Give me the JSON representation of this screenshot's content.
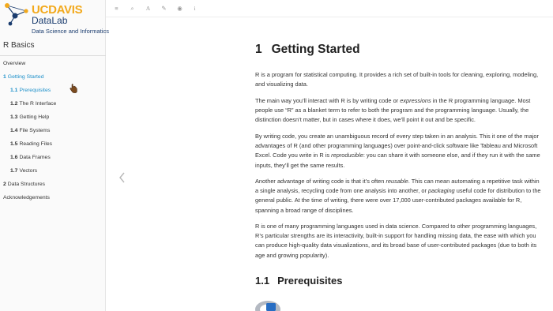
{
  "sidebar": {
    "logo": {
      "uc": "UC",
      "davis": "DAVIS",
      "datalab": "DataLab",
      "subtitle": "Data Science and Informatics"
    },
    "book_title": "R Basics",
    "toc": [
      {
        "num": "",
        "label": "Overview",
        "level": 1,
        "active": false
      },
      {
        "num": "1",
        "label": "Getting Started",
        "level": 1,
        "active": true
      },
      {
        "num": "1.1",
        "label": "Prerequisites",
        "level": 2,
        "active": true
      },
      {
        "num": "1.2",
        "label": "The R Interface",
        "level": 2,
        "active": false
      },
      {
        "num": "1.3",
        "label": "Getting Help",
        "level": 2,
        "active": false
      },
      {
        "num": "1.4",
        "label": "File Systems",
        "level": 2,
        "active": false
      },
      {
        "num": "1.5",
        "label": "Reading Files",
        "level": 2,
        "active": false
      },
      {
        "num": "1.6",
        "label": "Data Frames",
        "level": 2,
        "active": false
      },
      {
        "num": "1.7",
        "label": "Vectors",
        "level": 2,
        "active": false
      },
      {
        "num": "2",
        "label": "Data Structures",
        "level": 1,
        "active": false
      },
      {
        "num": "",
        "label": "Acknowledgements",
        "level": 1,
        "active": false
      }
    ]
  },
  "toolbar": {
    "icons": [
      "menu-icon",
      "search-icon",
      "font-icon",
      "edit-icon",
      "eye-icon",
      "info-icon"
    ],
    "glyphs": [
      "≡",
      "⌕",
      "A",
      "✎",
      "◉",
      "i"
    ]
  },
  "main": {
    "heading": {
      "num": "1",
      "text": "Getting Started"
    },
    "paragraphs": [
      {
        "id": "p1",
        "parts": [
          {
            "t": "R is a program for statistical computing. It provides a rich set of built-in tools for cleaning, exploring, modeling, and visualizing data.",
            "em": false
          }
        ]
      },
      {
        "id": "p2",
        "parts": [
          {
            "t": "The main way you’ll interact with R is by writing code or ",
            "em": false
          },
          {
            "t": "expressions",
            "em": true
          },
          {
            "t": " in the R programming language. Most people use “R” as a blanket term to refer to both the program and the programming language. Usually, the distinction doesn’t matter, but in cases where it does, we’ll point it out and be specific.",
            "em": false
          }
        ]
      },
      {
        "id": "p3",
        "parts": [
          {
            "t": "By writing code, you create an unambiguous record of every step taken in an analysis. This it one of the major advantages of R (and other programming languages) over point-and-click software like Tableau and Microsoft Excel. Code you write in R is ",
            "em": false
          },
          {
            "t": "reproducible",
            "em": true
          },
          {
            "t": ": you can share it with someone else, and if they run it with the same inputs, they’ll get the same results.",
            "em": false
          }
        ]
      },
      {
        "id": "p4",
        "parts": [
          {
            "t": "Another advantage of writing code is that it’s often ",
            "em": false
          },
          {
            "t": "reusable",
            "em": true
          },
          {
            "t": ". This can mean automating a repetitive task within a single analysis, recycling code from one analysis into another, or ",
            "em": false
          },
          {
            "t": "packaging",
            "em": true
          },
          {
            "t": " useful code for distribution to the general public. At the time of writing, there were over 17,000 user-contributed packages available for R, spanning a broad range of disciplines.",
            "em": false
          }
        ]
      },
      {
        "id": "p5",
        "parts": [
          {
            "t": "R is one of many programming languages used in data science. Compared to other programming languages, R’s particular strengths are its interactivity, built-in support for handling missing data, the ease with which you can produce high-quality data visualizations, and its broad base of user-contributed packages (due to both its age and growing popularity).",
            "em": false
          }
        ]
      }
    ],
    "subheading": {
      "num": "1.1",
      "text": "Prerequisites"
    }
  },
  "colors": {
    "accent": "#1b8fc9",
    "logo_gold": "#f2a91c",
    "logo_blue": "#1a3c6e"
  }
}
